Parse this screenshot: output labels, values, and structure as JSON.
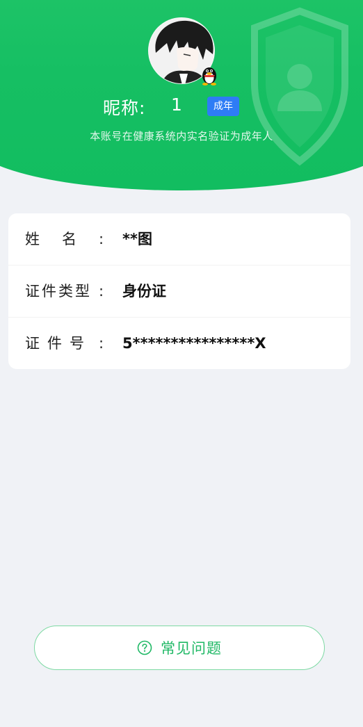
{
  "header": {
    "nickname_label": "昵称:",
    "nickname_value": "1",
    "adult_badge": "成年",
    "verify_text": "本账号在健康系统内实名验证为成年人"
  },
  "info": {
    "rows": [
      {
        "label": "姓名",
        "colon": ":",
        "value": "**图"
      },
      {
        "label": "证件类型",
        "colon": ":",
        "value": "身份证"
      },
      {
        "label": "证件号",
        "colon": ":",
        "value": "5****************X"
      }
    ]
  },
  "faq": {
    "label": "常见问题"
  },
  "icons": {
    "avatar": "avatar-image",
    "qq_badge": "qq-penguin-icon",
    "faq": "question-circle-icon",
    "decoration": "shield-user-icon"
  },
  "colors": {
    "header_green": "#16bf63",
    "badge_blue": "#2e7cf6",
    "faq_green": "#1fb865",
    "page_bg": "#f0f2f6"
  }
}
